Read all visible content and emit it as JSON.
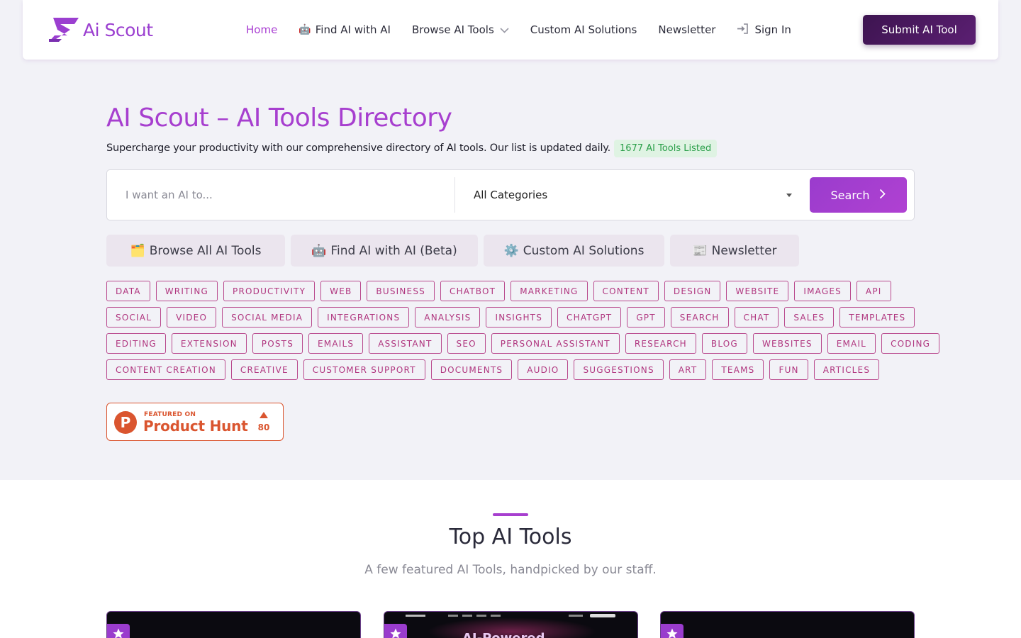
{
  "brand": {
    "name": "Ai Scout",
    "color": "#a73fcf"
  },
  "nav": {
    "items": [
      {
        "label": "Home",
        "active": true
      },
      {
        "label": "Find AI with AI",
        "emoji": "🤖"
      },
      {
        "label": "Browse AI Tools",
        "has_dropdown": true
      },
      {
        "label": "Custom AI Solutions"
      },
      {
        "label": "Newsletter"
      },
      {
        "label": "Sign In",
        "icon": "sign-in-icon"
      }
    ],
    "submit_label": "Submit AI Tool"
  },
  "hero": {
    "title": "AI Scout – AI Tools Directory",
    "subtitle": "Supercharge your productivity with our comprehensive directory of AI tools. Our list is updated daily.",
    "count_badge": "1677 AI Tools Listed"
  },
  "search": {
    "placeholder": "I want an AI to...",
    "category_selected": "All Categories",
    "button_label": "Search"
  },
  "quick_links": [
    {
      "emoji": "🗂️",
      "label": "Browse All AI Tools"
    },
    {
      "emoji": "🤖",
      "label": "Find AI with AI (Beta)"
    },
    {
      "emoji": "⚙️",
      "label": "Custom AI Solutions"
    },
    {
      "emoji": "📰",
      "label": "Newsletter"
    }
  ],
  "tags": [
    [
      "DATA",
      "WRITING",
      "PRODUCTIVITY",
      "WEB",
      "BUSINESS",
      "CHATBOT",
      "MARKETING",
      "CONTENT",
      "DESIGN",
      "WEBSITE",
      "IMAGES",
      "API"
    ],
    [
      "SOCIAL",
      "VIDEO",
      "SOCIAL MEDIA",
      "INTEGRATIONS",
      "ANALYSIS",
      "INSIGHTS",
      "CHATGPT",
      "GPT",
      "SEARCH",
      "CHAT",
      "SALES",
      "TEMPLATES"
    ],
    [
      "EDITING",
      "EXTENSION",
      "POSTS",
      "EMAILS",
      "ASSISTANT",
      "SEO",
      "PERSONAL ASSISTANT",
      "RESEARCH",
      "BLOG",
      "WEBSITES",
      "EMAIL",
      "CODING"
    ],
    [
      "CONTENT CREATION",
      "CREATIVE",
      "CUSTOMER SUPPORT",
      "DOCUMENTS",
      "AUDIO",
      "SUGGESTIONS",
      "ART",
      "TEAMS",
      "FUN",
      "ARTICLES"
    ]
  ],
  "product_hunt": {
    "featured": "FEATURED ON",
    "name": "Product Hunt",
    "upvotes": "80",
    "color": "#da552f"
  },
  "top_tools": {
    "title": "Top AI Tools",
    "subtitle": "A few featured AI Tools, handpicked by our staff.",
    "cards": [
      {
        "preview_text": ""
      },
      {
        "preview_text": "AI-Powered"
      },
      {
        "preview_text": ""
      }
    ]
  }
}
